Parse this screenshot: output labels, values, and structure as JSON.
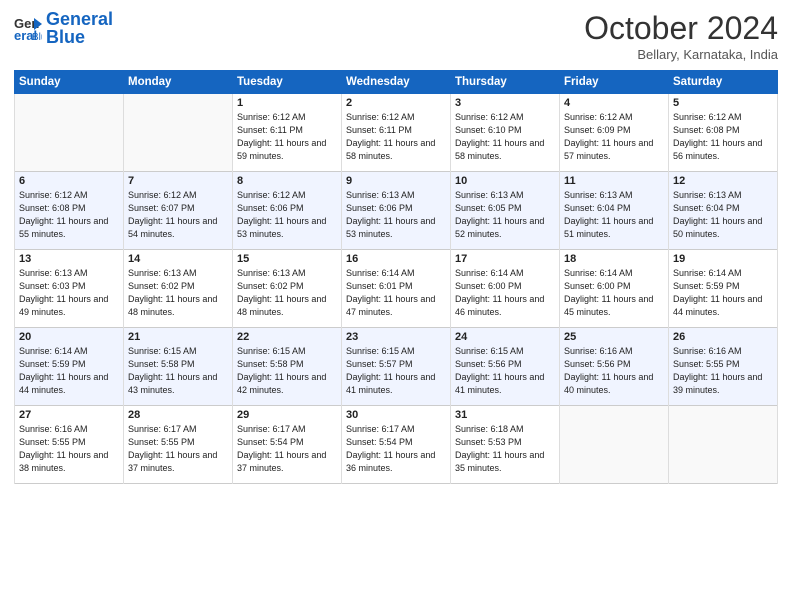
{
  "logo": {
    "general": "General",
    "blue": "Blue"
  },
  "header": {
    "month": "October 2024",
    "location": "Bellary, Karnataka, India"
  },
  "weekdays": [
    "Sunday",
    "Monday",
    "Tuesday",
    "Wednesday",
    "Thursday",
    "Friday",
    "Saturday"
  ],
  "weeks": [
    [
      {
        "day": "",
        "info": ""
      },
      {
        "day": "",
        "info": ""
      },
      {
        "day": "1",
        "info": "Sunrise: 6:12 AM\nSunset: 6:11 PM\nDaylight: 11 hours and 59 minutes."
      },
      {
        "day": "2",
        "info": "Sunrise: 6:12 AM\nSunset: 6:11 PM\nDaylight: 11 hours and 58 minutes."
      },
      {
        "day": "3",
        "info": "Sunrise: 6:12 AM\nSunset: 6:10 PM\nDaylight: 11 hours and 58 minutes."
      },
      {
        "day": "4",
        "info": "Sunrise: 6:12 AM\nSunset: 6:09 PM\nDaylight: 11 hours and 57 minutes."
      },
      {
        "day": "5",
        "info": "Sunrise: 6:12 AM\nSunset: 6:08 PM\nDaylight: 11 hours and 56 minutes."
      }
    ],
    [
      {
        "day": "6",
        "info": "Sunrise: 6:12 AM\nSunset: 6:08 PM\nDaylight: 11 hours and 55 minutes."
      },
      {
        "day": "7",
        "info": "Sunrise: 6:12 AM\nSunset: 6:07 PM\nDaylight: 11 hours and 54 minutes."
      },
      {
        "day": "8",
        "info": "Sunrise: 6:12 AM\nSunset: 6:06 PM\nDaylight: 11 hours and 53 minutes."
      },
      {
        "day": "9",
        "info": "Sunrise: 6:13 AM\nSunset: 6:06 PM\nDaylight: 11 hours and 53 minutes."
      },
      {
        "day": "10",
        "info": "Sunrise: 6:13 AM\nSunset: 6:05 PM\nDaylight: 11 hours and 52 minutes."
      },
      {
        "day": "11",
        "info": "Sunrise: 6:13 AM\nSunset: 6:04 PM\nDaylight: 11 hours and 51 minutes."
      },
      {
        "day": "12",
        "info": "Sunrise: 6:13 AM\nSunset: 6:04 PM\nDaylight: 11 hours and 50 minutes."
      }
    ],
    [
      {
        "day": "13",
        "info": "Sunrise: 6:13 AM\nSunset: 6:03 PM\nDaylight: 11 hours and 49 minutes."
      },
      {
        "day": "14",
        "info": "Sunrise: 6:13 AM\nSunset: 6:02 PM\nDaylight: 11 hours and 48 minutes."
      },
      {
        "day": "15",
        "info": "Sunrise: 6:13 AM\nSunset: 6:02 PM\nDaylight: 11 hours and 48 minutes."
      },
      {
        "day": "16",
        "info": "Sunrise: 6:14 AM\nSunset: 6:01 PM\nDaylight: 11 hours and 47 minutes."
      },
      {
        "day": "17",
        "info": "Sunrise: 6:14 AM\nSunset: 6:00 PM\nDaylight: 11 hours and 46 minutes."
      },
      {
        "day": "18",
        "info": "Sunrise: 6:14 AM\nSunset: 6:00 PM\nDaylight: 11 hours and 45 minutes."
      },
      {
        "day": "19",
        "info": "Sunrise: 6:14 AM\nSunset: 5:59 PM\nDaylight: 11 hours and 44 minutes."
      }
    ],
    [
      {
        "day": "20",
        "info": "Sunrise: 6:14 AM\nSunset: 5:59 PM\nDaylight: 11 hours and 44 minutes."
      },
      {
        "day": "21",
        "info": "Sunrise: 6:15 AM\nSunset: 5:58 PM\nDaylight: 11 hours and 43 minutes."
      },
      {
        "day": "22",
        "info": "Sunrise: 6:15 AM\nSunset: 5:58 PM\nDaylight: 11 hours and 42 minutes."
      },
      {
        "day": "23",
        "info": "Sunrise: 6:15 AM\nSunset: 5:57 PM\nDaylight: 11 hours and 41 minutes."
      },
      {
        "day": "24",
        "info": "Sunrise: 6:15 AM\nSunset: 5:56 PM\nDaylight: 11 hours and 41 minutes."
      },
      {
        "day": "25",
        "info": "Sunrise: 6:16 AM\nSunset: 5:56 PM\nDaylight: 11 hours and 40 minutes."
      },
      {
        "day": "26",
        "info": "Sunrise: 6:16 AM\nSunset: 5:55 PM\nDaylight: 11 hours and 39 minutes."
      }
    ],
    [
      {
        "day": "27",
        "info": "Sunrise: 6:16 AM\nSunset: 5:55 PM\nDaylight: 11 hours and 38 minutes."
      },
      {
        "day": "28",
        "info": "Sunrise: 6:17 AM\nSunset: 5:55 PM\nDaylight: 11 hours and 37 minutes."
      },
      {
        "day": "29",
        "info": "Sunrise: 6:17 AM\nSunset: 5:54 PM\nDaylight: 11 hours and 37 minutes."
      },
      {
        "day": "30",
        "info": "Sunrise: 6:17 AM\nSunset: 5:54 PM\nDaylight: 11 hours and 36 minutes."
      },
      {
        "day": "31",
        "info": "Sunrise: 6:18 AM\nSunset: 5:53 PM\nDaylight: 11 hours and 35 minutes."
      },
      {
        "day": "",
        "info": ""
      },
      {
        "day": "",
        "info": ""
      }
    ]
  ]
}
